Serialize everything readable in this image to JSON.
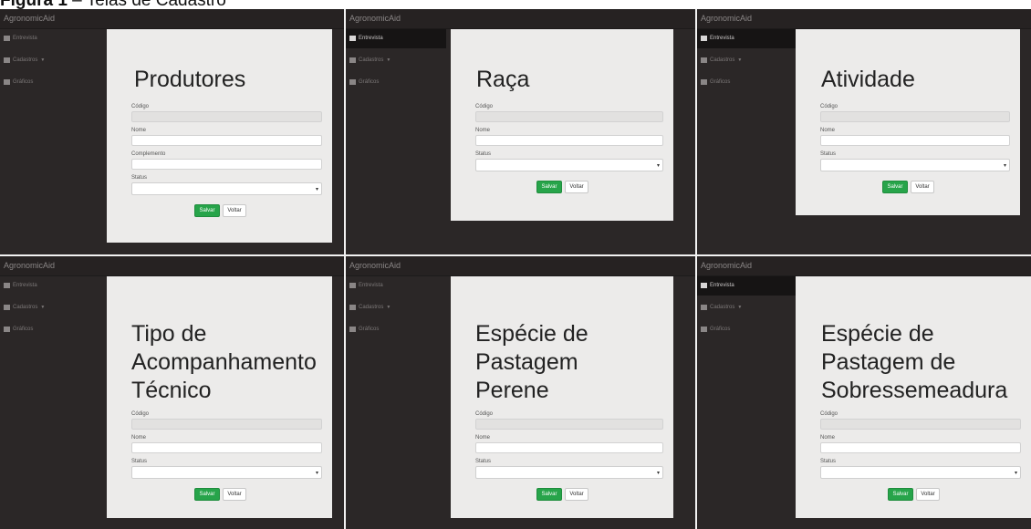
{
  "caption": {
    "figure": "Figura 1",
    "sep": " – ",
    "text": "Telas de Cadastro"
  },
  "app": {
    "brand": "AgronomicAid",
    "nav": {
      "item1": "Entrevista",
      "item2": "Cadastros",
      "item3": "Gráficos"
    }
  },
  "screens": [
    {
      "title_lines": [
        "Produtores"
      ],
      "fields": [
        "Código",
        "Nome",
        "Complemento"
      ],
      "select_label": "Status",
      "save": "Salvar",
      "back": "Voltar"
    },
    {
      "title_lines": [
        "Raça"
      ],
      "fields": [
        "Código",
        "Nome"
      ],
      "select_label": "Status",
      "save": "Salvar",
      "back": "Voltar"
    },
    {
      "title_lines": [
        "Atividade"
      ],
      "fields": [
        "Código",
        "Nome"
      ],
      "select_label": "Status",
      "save": "Salvar",
      "back": "Voltar"
    },
    {
      "title_lines": [
        "Tipo de",
        "Acompanhamento",
        "Técnico"
      ],
      "fields": [
        "Código",
        "Nome"
      ],
      "select_label": "Status",
      "save": "Salvar",
      "back": "Voltar"
    },
    {
      "title_lines": [
        "Espécie de",
        "Pastagem",
        "Perene"
      ],
      "fields": [
        "Código",
        "Nome"
      ],
      "select_label": "Status",
      "save": "Salvar",
      "back": "Voltar"
    },
    {
      "title_lines": [
        "Espécie de",
        "Pastagem de",
        "Sobressemeadura"
      ],
      "fields": [
        "Código",
        "Nome"
      ],
      "select_label": "Status",
      "save": "Salvar",
      "back": "Voltar"
    }
  ],
  "colors": {
    "sidebar": "#2b2727",
    "card": "#ecebea",
    "save_button": "#27a44a"
  }
}
